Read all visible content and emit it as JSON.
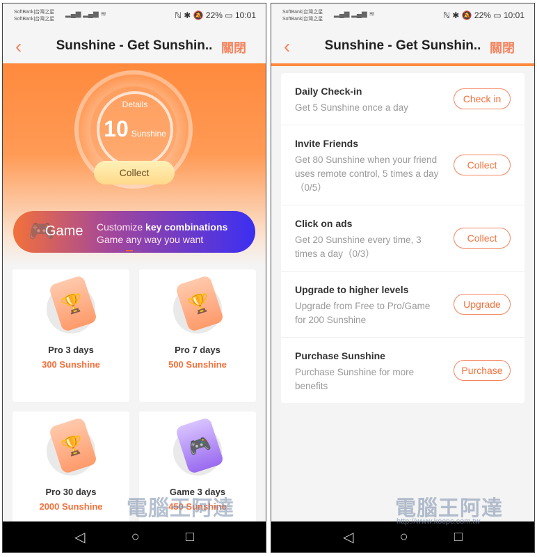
{
  "status": {
    "carrier1": "SoftBank|台灣之星",
    "carrier2": "SoftBank|台灣之星",
    "battery": "22%",
    "time": "10:01",
    "icons": "ℕ ✱ 🔕"
  },
  "header": {
    "title": "Sunshine - Get Sunshin..",
    "close": "關閉",
    "back_icon": "chevron-left-icon"
  },
  "hero": {
    "details": "Details",
    "amount": "10",
    "unit": "Sunshine",
    "collect": "Collect"
  },
  "banner": {
    "title": "Game",
    "line1_pre": "Customize ",
    "line1_bold": "key combinations",
    "line2": "Game any way you want"
  },
  "products": [
    {
      "name": "Pro 3 days",
      "price": "300 Sunshine",
      "icon": "trophy-icon"
    },
    {
      "name": "Pro 7 days",
      "price": "500 Sunshine",
      "icon": "trophy-icon"
    },
    {
      "name": "Pro 30 days",
      "price": "2000 Sunshine",
      "icon": "trophy-icon"
    },
    {
      "name": "Game 3 days",
      "price": "450 Sunshine",
      "icon": "gamepad-icon"
    }
  ],
  "tasks": [
    {
      "name": "Daily Check-in",
      "desc": "Get 5 Sunshine once a day",
      "button": "Check in"
    },
    {
      "name": "Invite Friends",
      "desc": "Get 80 Sunshine when your friend uses remote control, 5 times a day（0/5）",
      "button": "Collect"
    },
    {
      "name": "Click on ads",
      "desc": "Get 20 Sunshine every time, 3 times a day（0/3）",
      "button": "Collect"
    },
    {
      "name": "Upgrade to higher levels",
      "desc": "Upgrade from Free to Pro/Game for 200 Sunshine",
      "button": "Upgrade"
    },
    {
      "name": "Purchase Sunshine",
      "desc": "Purchase Sunshine for more benefits",
      "button": "Purchase"
    }
  ],
  "watermark": {
    "text": "電腦王阿達",
    "url": "http://www.kocpc.com.tw"
  },
  "colors": {
    "accent": "#f4703b",
    "hero": "#ff8a3d",
    "banner_end": "#3b2ff2"
  }
}
